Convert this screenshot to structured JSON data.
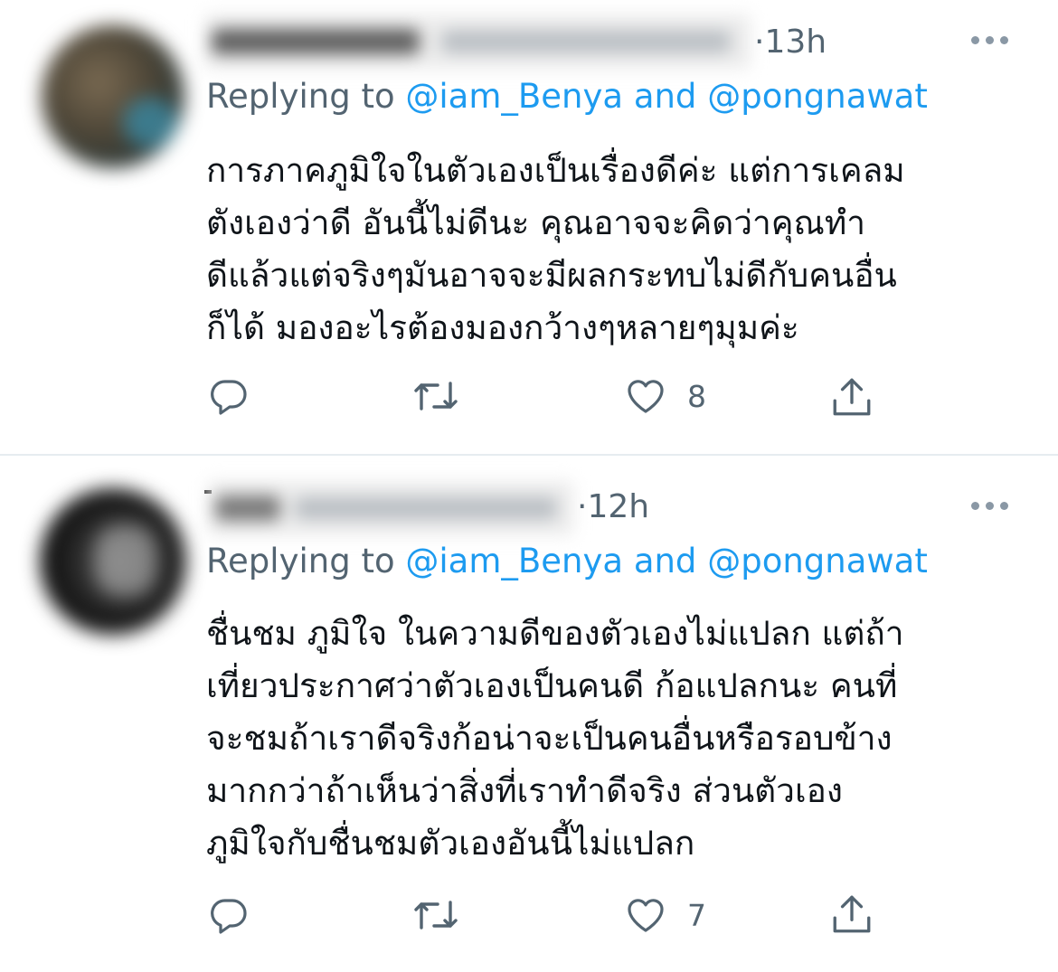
{
  "tweets": [
    {
      "time": "·13h",
      "reply_prefix": "Replying to",
      "reply_mention_1": "@iam_Benya",
      "reply_and": "and",
      "reply_mention_2": "@pongnawat",
      "body_lines": [
        "การภาคภูมิใจในตัวเองเป็นเรื่องดีค่ะ แต่การเคลม",
        "ตังเองว่าดี อันนี้ไม่ดีนะ คุณอาจจะคิดว่าคุณทำ",
        "ดีแล้วแต่จริงๆมันอาจจะมีผลกระทบไม่ดีกับคนอื่น",
        "ก็ได้ มองอะไรต้องมองกว้างๆหลายๆมุมค่ะ"
      ],
      "like_count": "8"
    },
    {
      "time": "·12h",
      "reply_prefix": "Replying to",
      "reply_mention_1": "@iam_Benya",
      "reply_and": "and",
      "reply_mention_2": "@pongnawat",
      "body_lines": [
        "ชื่นชม ภูมิใจ ในความดีของตัวเองไม่แปลก แต่ถ้า",
        "เที่ยวประกาศว่าตัวเองเป็นคนดี ก้อแปลกนะ คนที่",
        "จะชมถ้าเราดีจริงก้อน่าจะเป็นคนอื่นหรือรอบข้าง",
        "มากกว่าถ้าเห็นว่าสิ่งที่เราทำดีจริง ส่วนตัวเอง",
        "ภูมิใจกับชื่นชมตัวเองอันนี้ไม่แปลก"
      ],
      "like_count": "7"
    }
  ],
  "icons": {
    "reply": "speech-bubble",
    "retweet": "retweet-arrows",
    "like": "heart",
    "share": "share-arrow-up",
    "more": "three-dots"
  },
  "colors": {
    "text": "#0f1419",
    "secondary": "#536471",
    "mention": "#1d9bf0",
    "divider": "#e6ecf0"
  }
}
